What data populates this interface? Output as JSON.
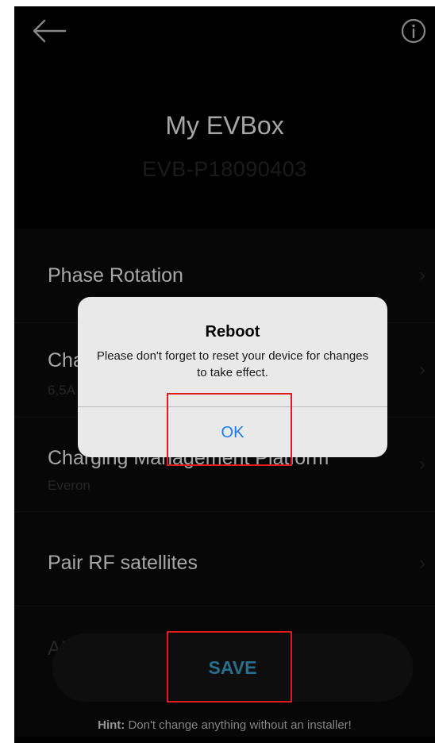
{
  "header": {
    "title": "My EVBox",
    "serial": "EVB-P18090403",
    "back_icon": "arrow-left-icon",
    "info_icon": "info-circle-icon"
  },
  "settings": {
    "rows": [
      {
        "label": "Phase Rotation",
        "sub": ""
      },
      {
        "label": "Charging current",
        "sub": "6,5A"
      },
      {
        "label": "Charging Management Platform",
        "sub": "Everon"
      },
      {
        "label": "Pair RF satellites",
        "sub": ""
      },
      {
        "label": "AE",
        "sub": ""
      }
    ]
  },
  "footer": {
    "save_label": "SAVE",
    "hint_bold": "Hint:",
    "hint_text": "Don't change anything without an installer!"
  },
  "dialog": {
    "title": "Reboot",
    "message": "Please don't forget to reset your device for changes to take effect.",
    "ok_label": "OK"
  },
  "colors": {
    "accent": "#41a9d8",
    "ios_blue": "#1d7bf0",
    "highlight": "#e01b1b",
    "background": "#000000"
  }
}
